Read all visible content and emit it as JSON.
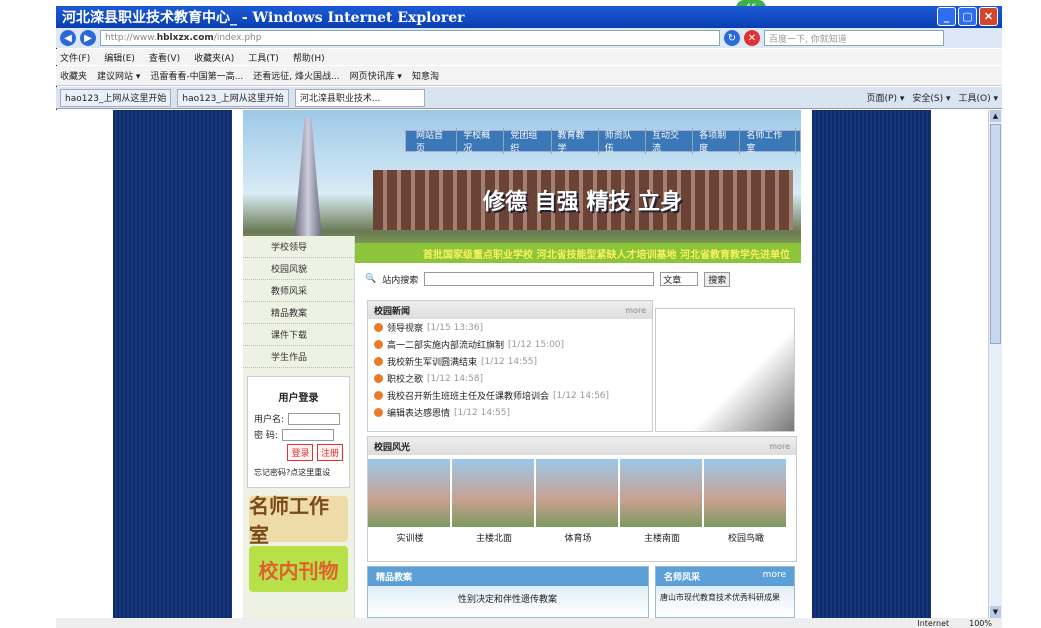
{
  "window": {
    "title": "河北滦县职业技术教育中心_ - Windows Internet Explorer",
    "counter": "46"
  },
  "address": {
    "url_prefix": "http://www.",
    "url_domain": "hblxzx.com",
    "url_path": "/index.php",
    "search_placeholder": "百度一下, 你就知道"
  },
  "menu": [
    "文件(F)",
    "编辑(E)",
    "查看(V)",
    "收藏夹(A)",
    "工具(T)",
    "帮助(H)"
  ],
  "favorites": [
    "收藏夹",
    "建议网站 ▾",
    "迅雷看看-中国第一高...",
    "还看远征, 烽火国战...",
    "网页快讯库 ▾",
    "知意淘"
  ],
  "tabs": [
    "hao123_上网从这里开始",
    "hao123_上网从这里开始",
    "河北滦县职业技术..."
  ],
  "tools": [
    "页面(P) ▾",
    "安全(S) ▾",
    "工具(O) ▾"
  ],
  "nav": [
    "网站首页",
    "学校概况",
    "党团组织",
    "教育教学",
    "师资队伍",
    "互动交流",
    "各项制度",
    "名师工作室"
  ],
  "slogan": "修德 自强 精技 立身",
  "marquee": "首批国家级重点职业学校  河北省技能型紧缺人才培训基地  河北省教育教学先进单位",
  "sidebar": [
    "学校领导",
    "校园风貌",
    "教师风采",
    "精品教案",
    "课件下载",
    "学生作品"
  ],
  "login": {
    "title": "用户登录",
    "user": "用户名:",
    "pass": "密 码:",
    "login_btn": "登录",
    "reg_btn": "注册",
    "forgot": "忘记密码?点这里重设"
  },
  "promo": [
    "名师工作室",
    "校内刊物"
  ],
  "search": {
    "label": "站内搜索",
    "select": "文章",
    "button": "搜索"
  },
  "news": {
    "title": "校园新闻",
    "more": "more",
    "items": [
      {
        "t": "领导视察",
        "d": "[1/15 13:36]"
      },
      {
        "t": "高一二部实施内部流动红旗制",
        "d": "[1/12 15:00]"
      },
      {
        "t": "我校新生军训圆满结束",
        "d": "[1/12 14:55]"
      },
      {
        "t": "职校之歌",
        "d": "[1/12 14:58]"
      },
      {
        "t": "我校召开新生班班主任及任课教师培训会",
        "d": "[1/12 14:56]"
      },
      {
        "t": "编辑表达感恩情",
        "d": "[1/12 14:55]"
      }
    ]
  },
  "gallery": {
    "title": "校园风光",
    "more": "more",
    "labels": [
      "实训楼",
      "主楼北面",
      "体育场",
      "主楼南面",
      "校园鸟瞰"
    ]
  },
  "bottom": {
    "left_title": "精品教案",
    "left_item": "性别决定和伴性遗传教案",
    "right_title": "名师风采",
    "right_more": "more",
    "right_item": "唐山市现代教育技术优秀科研成果"
  },
  "status": {
    "zone": "Internet",
    "zoom": "100%"
  }
}
